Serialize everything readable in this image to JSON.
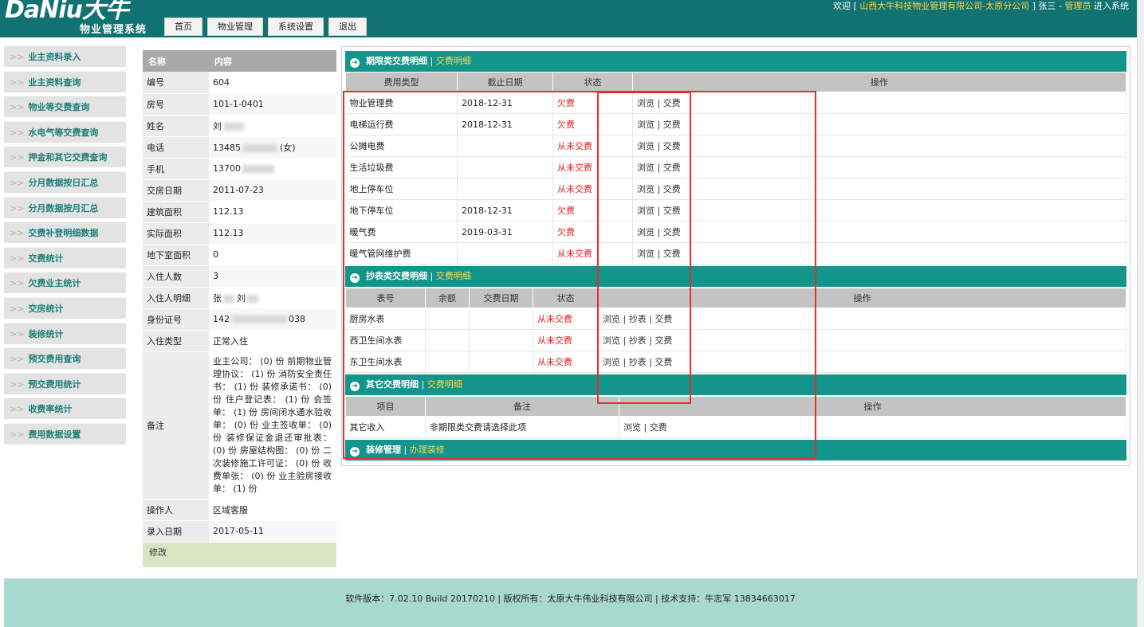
{
  "header": {
    "brand": "DaNiu大牛",
    "subtitle": "物业管理系统",
    "nav": [
      "首页",
      "物业管理",
      "系统设置",
      "退出"
    ],
    "welcome_prefix": "欢迎 [ ",
    "company": "山西大牛科技物业管理有限公司-太原分公司",
    "welcome_mid": " ] 张三 - ",
    "role": "管理员",
    "welcome_suffix": " 进入系统"
  },
  "sidebar": {
    "arrow": ">>",
    "items": [
      "业主资料录入",
      "业主资料查询",
      "物业等交费查询",
      "水电气等交费查询",
      "押金和其它交费查询",
      "分月数据按日汇总",
      "分月数据按月汇总",
      "交费补登明细数据",
      "交费统计",
      "欠费业主统计",
      "交房统计",
      "装修统计",
      "预交费用查询",
      "预交费用统计",
      "收费率统计",
      "费用数据设置"
    ]
  },
  "info": {
    "head": [
      "名称",
      "内容"
    ],
    "rows": [
      [
        "编号",
        "604"
      ],
      [
        "房号",
        "101-1-0401"
      ],
      [
        "姓名",
        "刘"
      ],
      [
        "电话",
        "13485"
      ],
      [
        "手机",
        "13700"
      ],
      [
        "交房日期",
        "2011-07-23"
      ],
      [
        "建筑面积",
        "112.13"
      ],
      [
        "实际面积",
        "112.13"
      ],
      [
        "地下室面积",
        "0"
      ],
      [
        "入住人数",
        "3"
      ],
      [
        "入住人明细",
        "张"
      ],
      [
        "身份证号",
        "142"
      ],
      [
        "入住类型",
        "正常入住"
      ]
    ],
    "phone_suffix": "(女)",
    "resident_part2": "刘",
    "id_tail": "038",
    "remark_label": "备注",
    "remark": "业主公司： (0) 份 前期物业管理协议： (1) 份 消防安全责任书： (1) 份 装修承诺书： (0) 份 住户登记表： (1) 份 会签单： (1) 份 房间闭水通水验收单： (0) 份 业主签收单： (0) 份 装修保证金退还审批表： (0) 份 房屋结构图： (0) 份 二次装修施工许可证： (0) 份 收费单张： (0) 份 业主验房接收单： (1) 份",
    "after": [
      [
        "操作人",
        "区域客服"
      ],
      [
        "录入日期",
        "2017-05-11"
      ]
    ],
    "edit": "修改"
  },
  "sec1": {
    "title": "期限类交费明细",
    "sep": " | ",
    "link": "交费明细",
    "cols": [
      "费用类型",
      "截止日期",
      "状态",
      "操作"
    ],
    "rows": [
      [
        "物业管理费",
        "2018-12-31",
        "欠费"
      ],
      [
        "电梯运行费",
        "2018-12-31",
        "欠费"
      ],
      [
        "公摊电费",
        "",
        "从未交费"
      ],
      [
        "生活垃圾费",
        "",
        "从未交费"
      ],
      [
        "地上停车位",
        "",
        "从未交费"
      ],
      [
        "地下停车位",
        "2018-12-31",
        "欠费"
      ],
      [
        "暖气费",
        "2019-03-31",
        "欠费"
      ],
      [
        "暖气管网维护费",
        "",
        "从未交费"
      ]
    ],
    "ops": [
      "浏览",
      "交费"
    ]
  },
  "sec2": {
    "title": "抄表类交费明细",
    "sep": " | ",
    "link": "交费明细",
    "cols": [
      "表号",
      "余额",
      "交费日期",
      "状态",
      "操作"
    ],
    "rows": [
      [
        "厨房水表",
        "",
        "",
        "从未交费"
      ],
      [
        "西卫生间水表",
        "",
        "",
        "从未交费"
      ],
      [
        "东卫生间水表",
        "",
        "",
        "从未交费"
      ]
    ],
    "ops": [
      "浏览",
      "抄表",
      "交费"
    ]
  },
  "sec3": {
    "title": "其它交费明细",
    "sep": " | ",
    "link": "交费明细",
    "cols": [
      "项目",
      "备注",
      "操作"
    ],
    "rows": [
      [
        "其它收入",
        "非期限类交费请选择此项"
      ]
    ],
    "ops": [
      "浏览",
      "交费"
    ]
  },
  "sec4": {
    "title": "装修管理",
    "sep": " | ",
    "link": "办理装修"
  },
  "footer": "软件版本：7.02.10 Build 20170210 | 版权所有：太原大牛伟业科技有限公司 | 技术支持：牛志军 13834663017",
  "colors": {
    "header": "#117272",
    "section": "#12958a",
    "accent": "#ffd84a",
    "owe": "#e02020",
    "footer": "#a8d9ce"
  }
}
